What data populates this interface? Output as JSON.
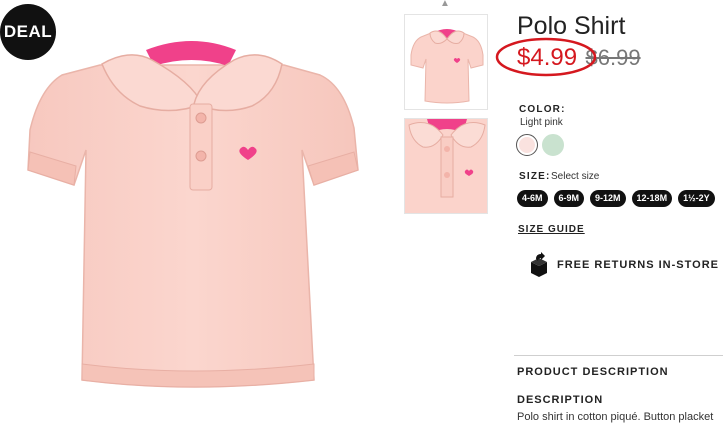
{
  "badge": {
    "label": "DEAL"
  },
  "product": {
    "title": "Polo Shirt",
    "price_current": "$4.99",
    "price_original": "$6.99"
  },
  "color": {
    "label": "COLOR:",
    "selected": "Light pink",
    "swatches": [
      "#fae2df",
      "#c9e2cf"
    ]
  },
  "size": {
    "label": "SIZE:",
    "hint": "Select size",
    "options": [
      "4-6M",
      "6-9M",
      "9-12M",
      "12-18M",
      "1½-2Y"
    ]
  },
  "links": {
    "size_guide": "SIZE GUIDE",
    "returns": "FREE RETURNS IN-STORE"
  },
  "description": {
    "section_heading": "PRODUCT DESCRIPTION",
    "heading": "DESCRIPTION",
    "text": "Polo shirt in cotton piqué. Button placket"
  },
  "colors": {
    "price_red": "#d5181f",
    "annotation_circle": "#d5181f",
    "shirt_pink": "#fbd3cb",
    "collar_accent": "#f0418a"
  },
  "icons": [
    "chevron-up-icon",
    "returns-box-icon",
    "heart-icon"
  ]
}
